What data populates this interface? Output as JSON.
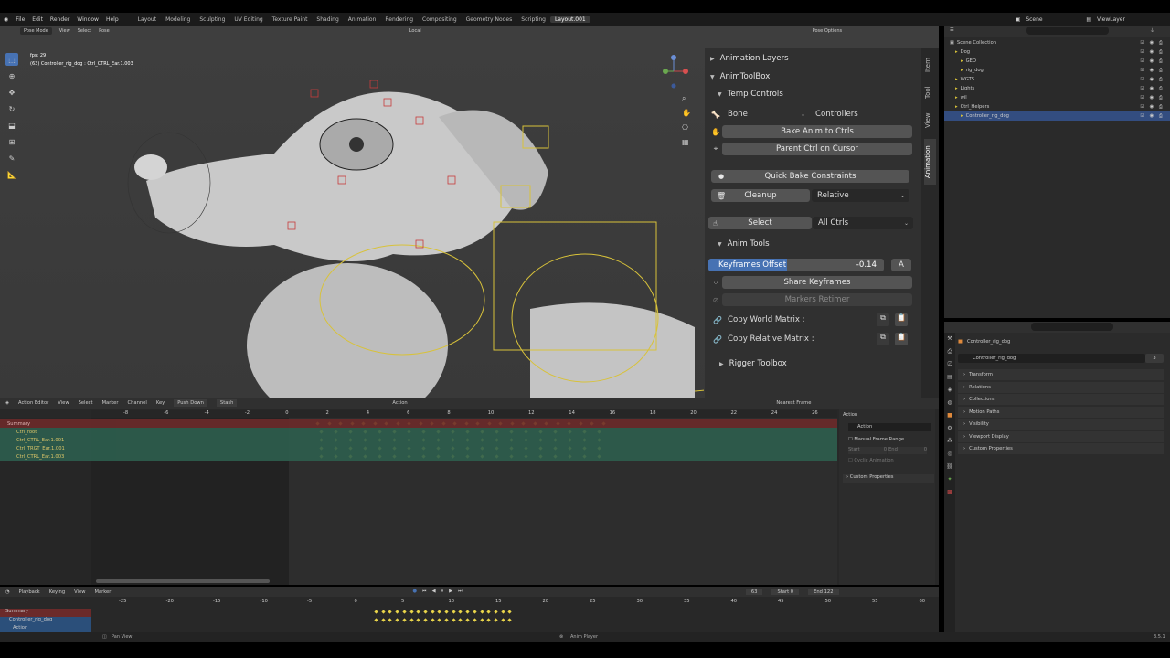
{
  "menu": {
    "items": [
      "File",
      "Edit",
      "Render",
      "Window",
      "Help"
    ],
    "workspaces": [
      "Layout",
      "Modeling",
      "Sculpting",
      "UV Editing",
      "Texture Paint",
      "Shading",
      "Animation",
      "Rendering",
      "Compositing",
      "Geometry Nodes",
      "Scripting",
      "Layout.001"
    ],
    "active_workspace": "Layout.001",
    "scene": "Scene",
    "view_layer": "ViewLayer"
  },
  "viewport": {
    "mode": "Pose Mode",
    "menus": [
      "View",
      "Select",
      "Pose"
    ],
    "orientation": "Local",
    "pose_options": "Pose Options",
    "fps_text": "fps: 29",
    "object_text": "(63) Controller_rig_dog : Ctrl_CTRL_Ear.1.003"
  },
  "npanel": {
    "tabs": [
      "Item",
      "Tool",
      "View",
      "Animation"
    ],
    "active_tab": "Animation",
    "animation_layers": "Animation Layers",
    "animtoolbox": "AnimToolBox",
    "temp_controls": "Temp Controls",
    "bone_dropdown": "Bone",
    "controllers_label": "Controllers",
    "bake_anim": "Bake Anim to Ctrls",
    "parent_ctrl": "Parent Ctrl on Cursor",
    "quick_bake": "Quick Bake Constraints",
    "cleanup": "Cleanup",
    "relative_dropdown": "Relative",
    "select": "Select",
    "all_ctrls": "All Ctrls",
    "anim_tools": "Anim Tools",
    "keyframes_offset_label": "Keyframes Offset",
    "keyframes_offset_value": "-0.14",
    "keyframes_offset_fill": 0.45,
    "a_button": "A",
    "share_keyframes": "Share Keyframes",
    "markers_retimer": "Markers Retimer",
    "copy_world": "Copy World Matrix :",
    "copy_relative": "Copy Relative Matrix :",
    "rigger_toolbox": "Rigger Toolbox"
  },
  "outliner": {
    "rows": [
      {
        "label": "Scene Collection",
        "indent": 0,
        "selected": false
      },
      {
        "label": "Dog",
        "indent": 1,
        "selected": false
      },
      {
        "label": "GEO",
        "indent": 2,
        "selected": false
      },
      {
        "label": "rig_dog",
        "indent": 2,
        "selected": false
      },
      {
        "label": "WGTS",
        "indent": 1,
        "selected": false
      },
      {
        "label": "Lights",
        "indent": 1,
        "selected": false
      },
      {
        "label": "wil",
        "indent": 1,
        "selected": false
      },
      {
        "label": "Ctrl_Helpers",
        "indent": 1,
        "selected": false
      },
      {
        "label": "Controller_rig_dog",
        "indent": 2,
        "selected": true
      }
    ]
  },
  "properties": {
    "object_name": "Controller_rig_dog",
    "field_name": "Controller_rig_dog",
    "field_count": "3",
    "sections": [
      "Transform",
      "Relations",
      "Collections",
      "Motion Paths",
      "Visibility",
      "Viewport Display",
      "Custom Properties"
    ]
  },
  "action_editor": {
    "editor": "Action Editor",
    "menus": [
      "View",
      "Select",
      "Marker",
      "Channel",
      "Key"
    ],
    "push_down": "Push Down",
    "stash": "Stash",
    "action_name": "Action",
    "snapping": "Nearest Frame",
    "frame_ticks": [
      "-8",
      "-6",
      "-4",
      "-2",
      "0",
      "2",
      "4",
      "6",
      "8",
      "10",
      "12",
      "14",
      "16",
      "18",
      "20",
      "22",
      "24",
      "26"
    ],
    "channels": [
      {
        "label": "Summary",
        "kind": "summary"
      },
      {
        "label": "Ctrl_root",
        "kind": "channel"
      },
      {
        "label": "Ctrl_CTRL_Ear.1.001",
        "kind": "channel"
      },
      {
        "label": "Ctrl_TRGT_Ear.1.001",
        "kind": "channel"
      },
      {
        "label": "Ctrl_CTRL_Ear.1.003",
        "kind": "channel"
      }
    ],
    "side_panel": {
      "section": "Action",
      "action_field": "Action",
      "manual_frame_range": "Manual Frame Range",
      "start_label": "Start",
      "start_value": "0",
      "end_label": "End",
      "end_value": "0",
      "cyclic": "Cyclic Animation",
      "custom_properties": "Custom Properties"
    }
  },
  "timeline": {
    "menus": [
      "Playback",
      "Keying",
      "View",
      "Marker"
    ],
    "current_frame": "63",
    "start_label": "Start",
    "start_value": "0",
    "end_label": "End",
    "end_value": "122",
    "ticks": [
      "-25",
      "-20",
      "-15",
      "-10",
      "-5",
      "0",
      "5",
      "10",
      "15",
      "20",
      "25",
      "30",
      "35",
      "40",
      "45",
      "50",
      "55",
      "60"
    ],
    "channels": [
      "Summary",
      "Controller_rig_dog",
      "Action"
    ]
  },
  "status": {
    "pan_view": "Pan View",
    "anim_player": "Anim Player",
    "version": "3.5.1"
  },
  "colors": {
    "accent": "#4772b3",
    "rig_yellow": "#d8c23a",
    "rig_red": "#c83c3c",
    "keyframe": "#e8d44a"
  }
}
